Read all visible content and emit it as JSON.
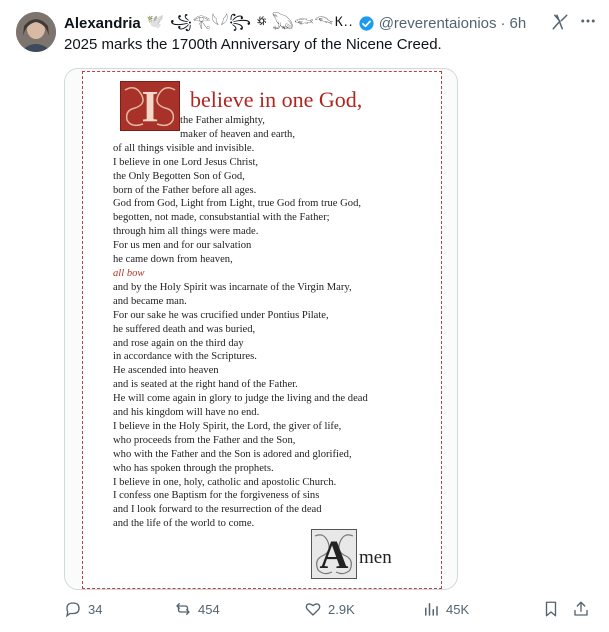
{
  "tweet": {
    "author_name": "Alexandria",
    "author_decoration": "🕊️ ꧁𓂀𓆩𓆪꧂ ꥟ 𓆏𓆟𓆞К...",
    "handle": "@reverentaionios",
    "dot": "·",
    "time": "6h",
    "text": "2025 marks the 1700th Anniversary of the Nicene Creed."
  },
  "creed": {
    "drop_cap": "I",
    "headline": "believe in one God,",
    "lines": [
      "the Father almighty,",
      "maker of heaven and earth,",
      "of all things visible and invisible.",
      "I believe in one Lord Jesus Christ,",
      "the Only Begotten Son of God,",
      "born of the Father before all ages.",
      "God from God, Light from Light, true God from true God,",
      "begotten, not made, consubstantial with the Father;",
      "through him all things were made.",
      "For us men and for our salvation",
      "he came down from heaven,",
      "all bow",
      "and by the Holy Spirit was incarnate of the Virgin Mary,",
      "and became man.",
      "For our sake he was crucified under Pontius Pilate,",
      "he suffered death and was buried,",
      "and rose again on the third day",
      "in accordance with the Scriptures.",
      "He ascended into heaven",
      "and is seated at the right hand of the Father.",
      "He will come again in glory to judge the living and the dead",
      "and his kingdom will have no end.",
      "I believe in the Holy Spirit, the Lord, the giver of life,",
      "who proceeds from the Father and the Son,",
      "who with the Father and the Son is adored and glorified,",
      "who has spoken through the prophets.",
      "I believe in one, holy, catholic and apostolic Church.",
      "I confess one Baptism for the forgiveness of sins",
      "and I look forward to the resurrection of the dead",
      "and the life of the world to come."
    ],
    "amen_cap": "A",
    "amen_rest": "men"
  },
  "actions": {
    "replies": "34",
    "reposts": "454",
    "likes": "2.9K",
    "views": "45K"
  },
  "colors": {
    "accent_red": "#b0261f",
    "verified_blue": "#1d9bf0",
    "muted_text": "#536471"
  }
}
